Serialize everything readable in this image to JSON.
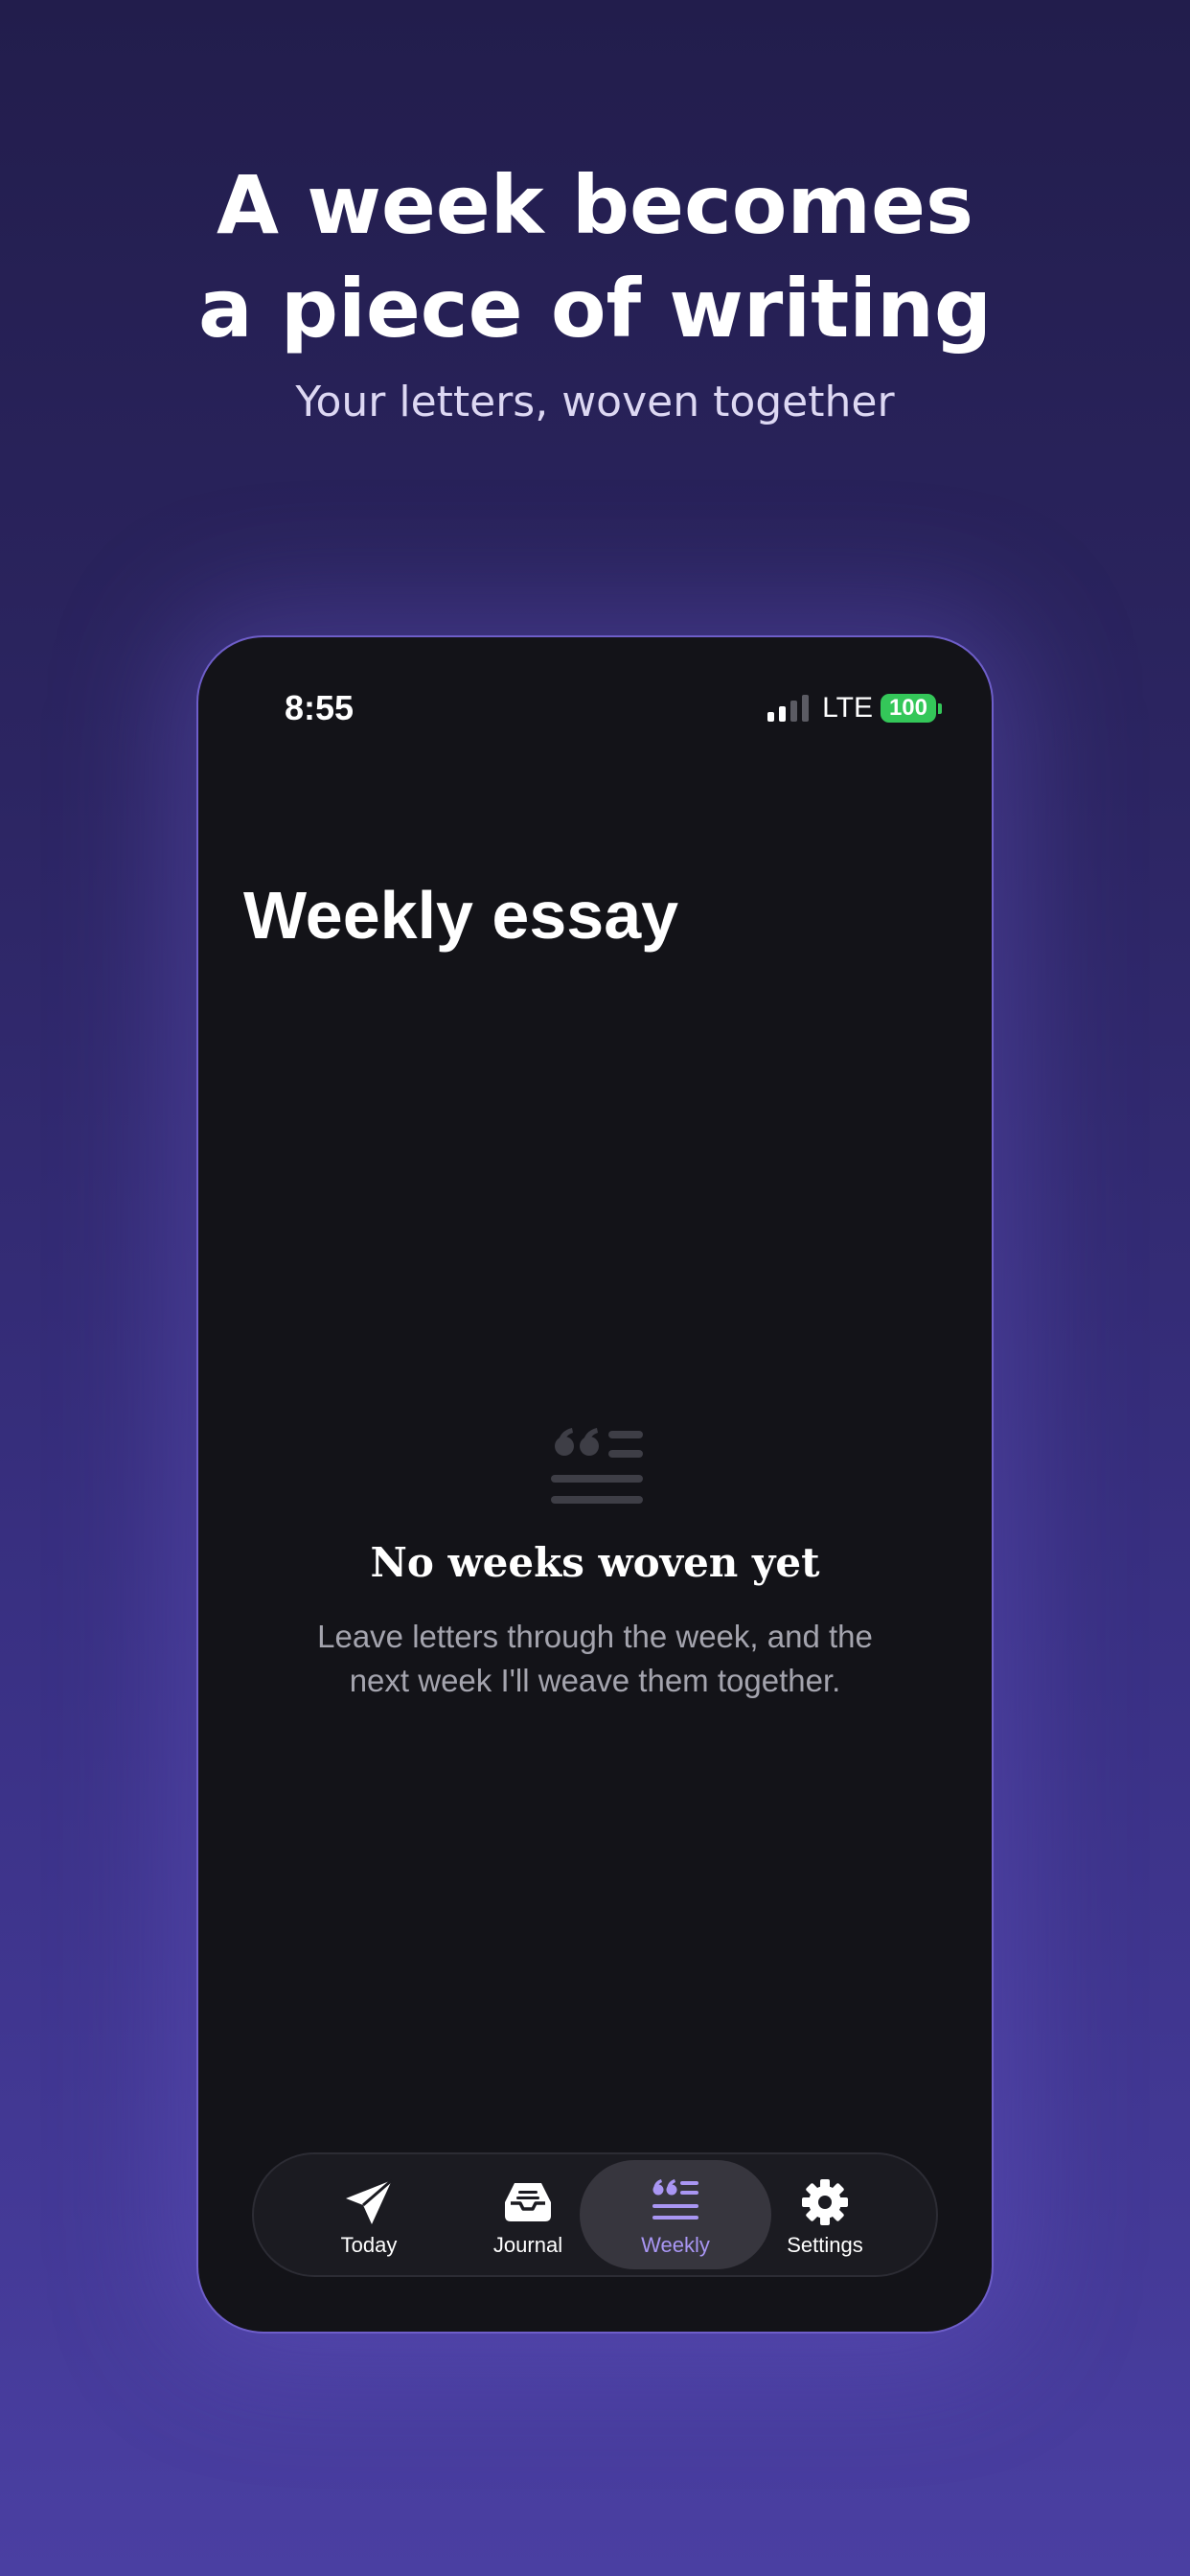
{
  "hero": {
    "headline_line1": "A week becomes",
    "headline_line2": "a piece of writing",
    "subheadline": "Your letters, woven together"
  },
  "status_bar": {
    "time": "8:55",
    "network": "LTE",
    "battery": "100",
    "signal_bars_active": 2,
    "signal_bars_total": 4
  },
  "screen": {
    "title": "Weekly essay",
    "empty_state": {
      "icon": "quote-lines-icon",
      "title": "No weeks woven yet",
      "body": "Leave letters through the week, and the next week I'll weave them together."
    }
  },
  "tab_bar": {
    "active": "weekly",
    "tabs": [
      {
        "id": "today",
        "label": "Today",
        "icon": "paper-plane-icon"
      },
      {
        "id": "journal",
        "label": "Journal",
        "icon": "inbox-tray-icon"
      },
      {
        "id": "weekly",
        "label": "Weekly",
        "icon": "quote-lines-icon"
      },
      {
        "id": "settings",
        "label": "Settings",
        "icon": "gear-icon"
      }
    ]
  },
  "colors": {
    "background_top": "#221d4c",
    "background_bottom": "#4a3fa2",
    "screen_background": "#131318",
    "accent": "#a996f3",
    "battery": "#34c759",
    "muted_text": "#a4a4ae"
  }
}
